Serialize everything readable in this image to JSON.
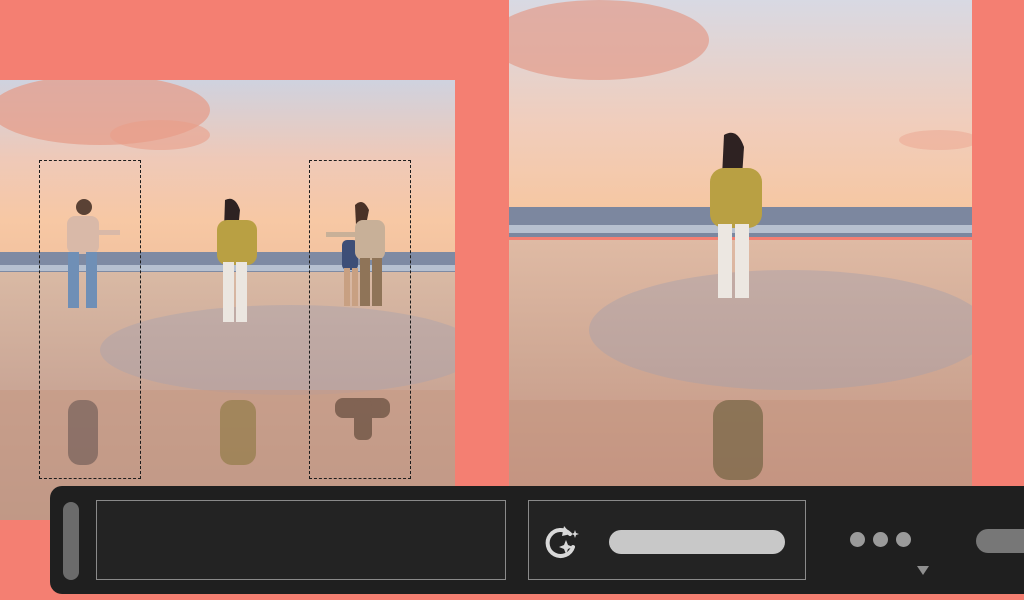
{
  "canvas": {
    "background": "#f47f72"
  },
  "photos": {
    "before": {
      "description_icon": "beach-photo-with-three-people"
    },
    "after": {
      "description_icon": "beach-photo-with-one-person"
    }
  },
  "selections": {
    "count": 2,
    "border_style": "dashed"
  },
  "toolbar": {
    "background": "#1f1f1f",
    "magic_icon": "magic-rotate-sparkle-icon",
    "more_icon": "more-options-icon",
    "dropdown_icon": "caret-down-icon"
  }
}
